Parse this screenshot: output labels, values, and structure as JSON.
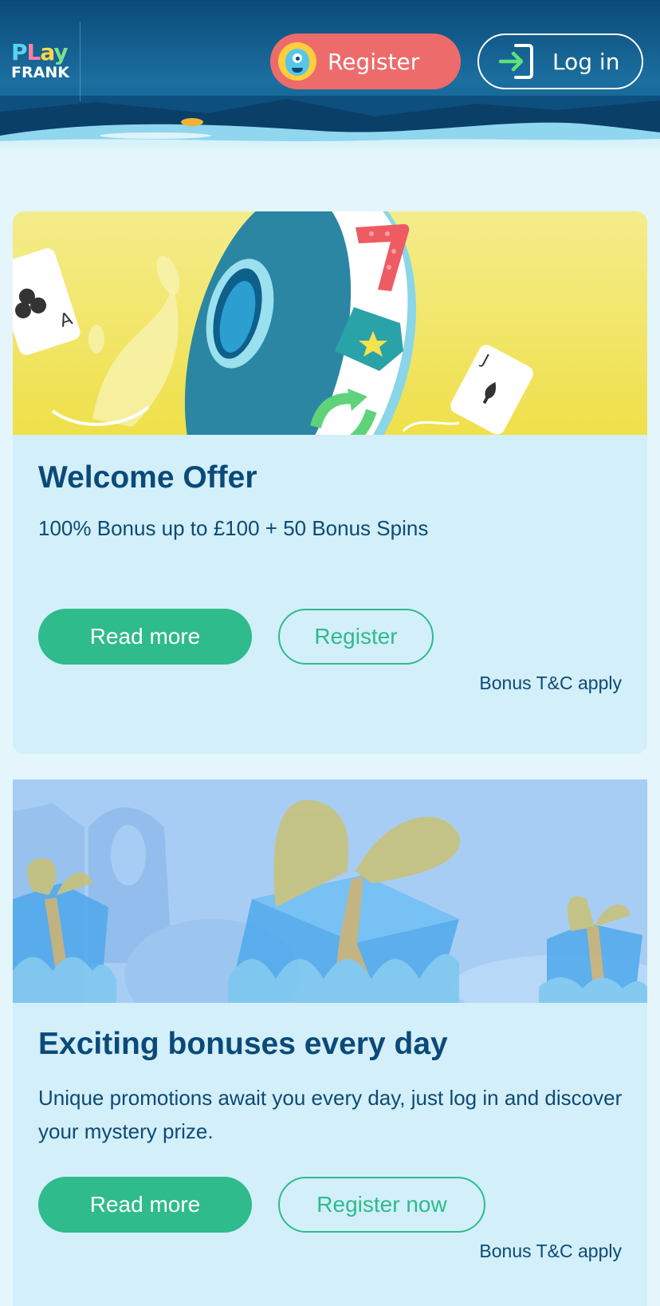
{
  "header": {
    "logo": {
      "top": "PLAY",
      "bottom": "FRANK",
      "top_letters": [
        "P",
        "L",
        "a",
        "y"
      ]
    },
    "register_label": "Register",
    "login_label": "Log in"
  },
  "promotions": [
    {
      "title": "Welcome Offer",
      "text": "100% Bonus up to £100 + 50 Bonus Spins",
      "primary_label": "Read more",
      "secondary_label": "Register",
      "terms": "Bonus T&C apply"
    },
    {
      "title": "Exciting bonuses every day",
      "text": "Unique promotions await you every day, just log in and discover your mystery prize.",
      "primary_label": "Read more",
      "secondary_label": "Register now",
      "terms": "Bonus T&C apply"
    }
  ],
  "colors": {
    "header": "#0b4a78",
    "register_accent": "#ee6b6b",
    "primary_green": "#2fbb8c",
    "card_bg": "#d2effa",
    "title": "#0b4a78",
    "banner1_bg": "#f2e96a",
    "banner2_bg": "#a8cdf4"
  }
}
